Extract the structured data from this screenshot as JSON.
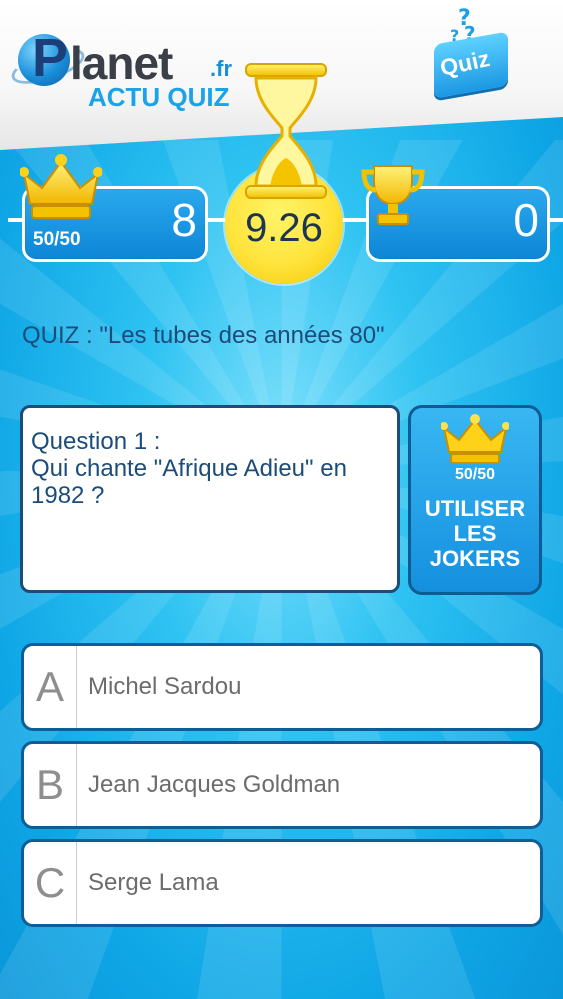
{
  "header": {
    "logo_brand_p": "P",
    "logo_brand_rest": "lanet",
    "logo_tld": ".fr",
    "logo_sub": "ACTU QUIZ",
    "quiz_badge": "Quiz"
  },
  "scores": {
    "left_badge": "50/50",
    "left_value": "8",
    "right_value": "0"
  },
  "timer": {
    "value": "9.26"
  },
  "quiz": {
    "title": "QUIZ : \"Les tubes des années 80\""
  },
  "question": {
    "number": "Question 1 :",
    "text": "Qui chante \"Afrique Adieu\" en 1982 ?"
  },
  "joker": {
    "badge": "50/50",
    "label": "UTILISER\nLES\nJOKERS"
  },
  "answers": [
    {
      "letter": "A",
      "text": "Michel Sardou"
    },
    {
      "letter": "B",
      "text": "Jean Jacques Goldman"
    },
    {
      "letter": "C",
      "text": "Serge Lama"
    }
  ],
  "colors": {
    "accent_blue": "#1aa3e8",
    "timer_yellow": "#ffe33a",
    "dark_text": "#1b4c7a"
  }
}
